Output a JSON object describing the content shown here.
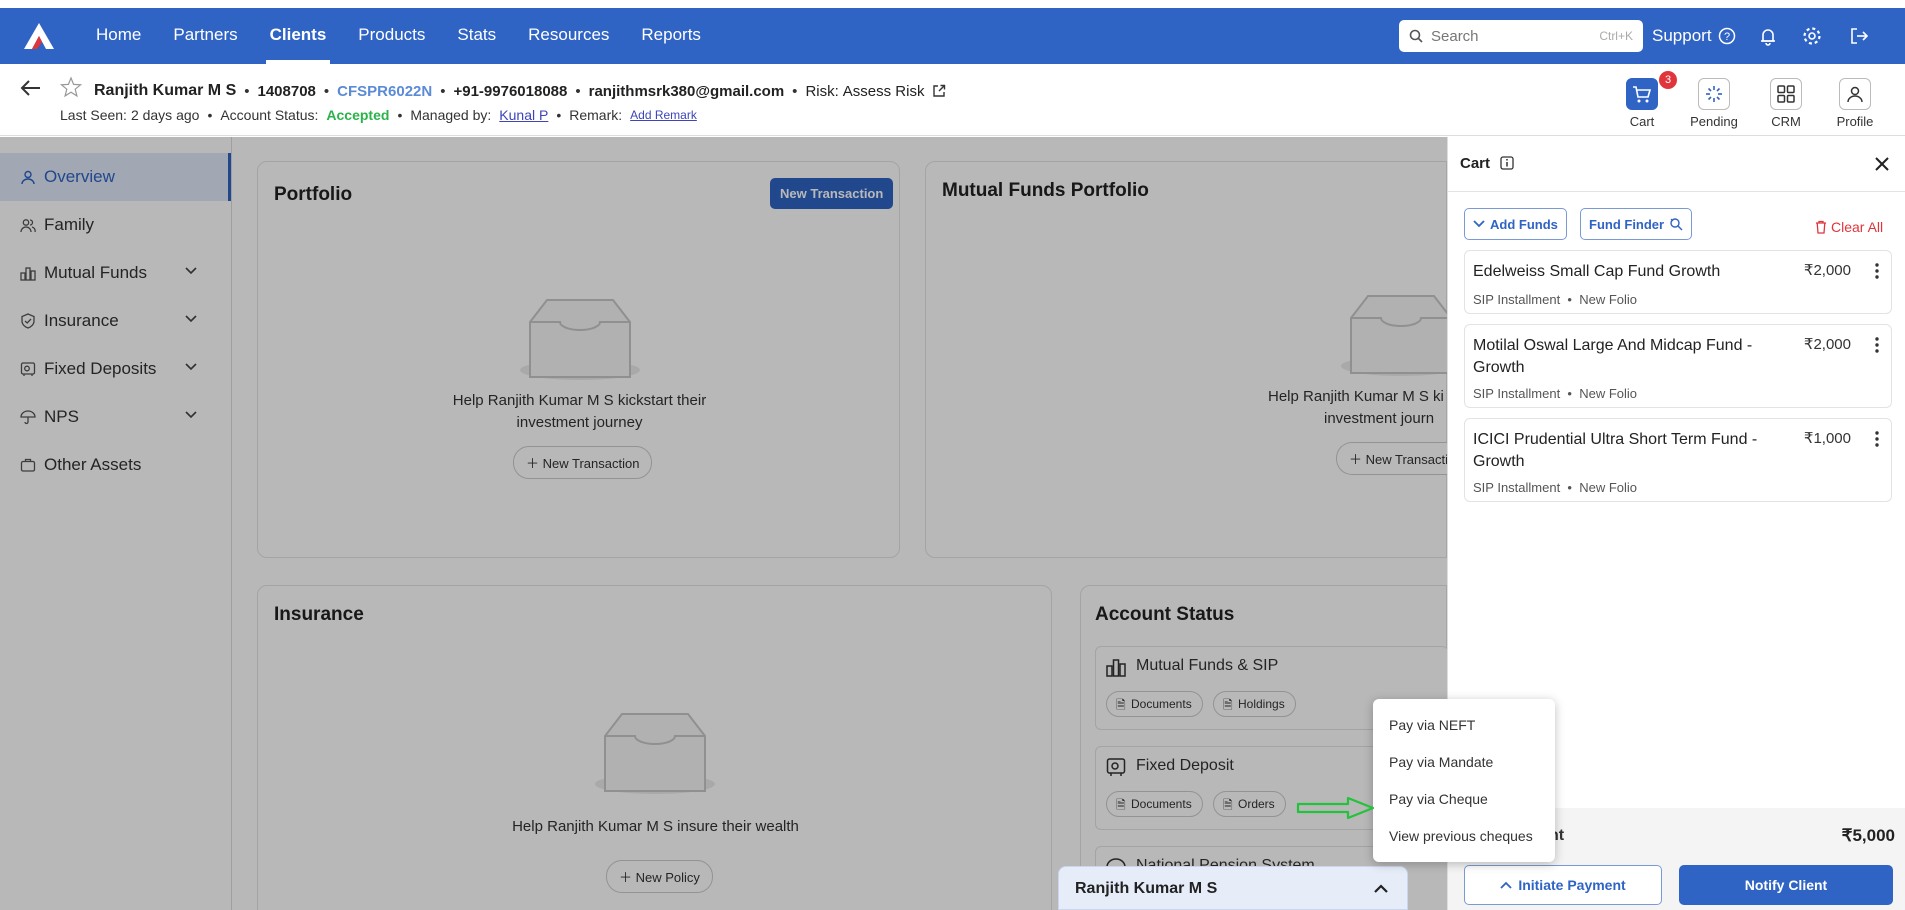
{
  "nav": {
    "items": [
      {
        "label": "Home",
        "active": false
      },
      {
        "label": "Partners",
        "active": false
      },
      {
        "label": "Clients",
        "active": true
      },
      {
        "label": "Products",
        "active": false
      },
      {
        "label": "Stats",
        "active": false
      },
      {
        "label": "Resources",
        "active": false
      },
      {
        "label": "Reports",
        "active": false
      }
    ],
    "search_placeholder": "Search",
    "search_shortcut": "Ctrl+K",
    "support_label": "Support"
  },
  "client": {
    "name": "Ranjith Kumar M S",
    "id": "1408708",
    "pan": "CFSPR6022N",
    "phone": "+91-9976018088",
    "email": "ranjithmsrk380@gmail.com",
    "risk_label": "Risk:",
    "risk_value": "Assess Risk",
    "last_seen_label": "Last Seen:",
    "last_seen_value": "2 days ago",
    "status_label": "Account Status:",
    "status_value": "Accepted",
    "managed_label": "Managed by:",
    "managed_value": "Kunal P",
    "remark_label": "Remark:",
    "remark_action": "Add Remark"
  },
  "quick_actions": [
    {
      "label": "Cart",
      "badge": "3"
    },
    {
      "label": "Pending"
    },
    {
      "label": "CRM"
    },
    {
      "label": "Profile"
    }
  ],
  "sidebar": {
    "items": [
      {
        "label": "Overview"
      },
      {
        "label": "Family"
      },
      {
        "label": "Mutual Funds"
      },
      {
        "label": "Insurance"
      },
      {
        "label": "Fixed Deposits"
      },
      {
        "label": "NPS"
      },
      {
        "label": "Other Assets"
      }
    ]
  },
  "portfolio": {
    "title": "Portfolio",
    "new_transaction": "New Transaction",
    "empty_text_line1": "Help Ranjith Kumar M S kickstart their",
    "empty_text_line2": "investment journey",
    "empty_button": "New Transaction"
  },
  "mf_portfolio": {
    "title": "Mutual Funds Portfolio",
    "empty_text_line1": "Help Ranjith Kumar M S ki",
    "empty_text_line2": "investment journ",
    "empty_button": "New Transactio"
  },
  "insurance": {
    "title": "Insurance",
    "empty_text": "Help Ranjith Kumar M S insure their wealth",
    "empty_button": "New Policy"
  },
  "account_status": {
    "title": "Account Status",
    "rows": [
      {
        "title": "Mutual Funds & SIP",
        "chips": [
          "Documents",
          "Holdings"
        ]
      },
      {
        "title": "Fixed Deposit",
        "chips": [
          "Documents",
          "Orders"
        ]
      },
      {
        "title": "National Pension System",
        "chips": []
      }
    ]
  },
  "dock": {
    "name": "Ranjith Kumar M S"
  },
  "cart": {
    "title": "Cart",
    "add_funds": "Add Funds",
    "fund_finder": "Fund Finder",
    "clear_all": "Clear All",
    "items": [
      {
        "name": "Edelweiss Small Cap Fund Growth",
        "amount": "₹2,000",
        "type": "SIP Installment",
        "folio": "New Folio"
      },
      {
        "name": "Motilal Oswal Large And Midcap Fund - Growth",
        "amount": "₹2,000",
        "type": "SIP Installment",
        "folio": "New Folio"
      },
      {
        "name": "ICICI Prudential Ultra Short Term Fund - Growth",
        "amount": "₹1,000",
        "type": "SIP Installment",
        "folio": "New Folio"
      }
    ],
    "total_label_partial": "nt",
    "total_amount": "₹5,000",
    "initiate_payment": "Initiate Payment",
    "notify_client": "Notify Client"
  },
  "payment_menu": {
    "items": [
      "Pay via NEFT",
      "Pay via Mandate",
      "Pay via Cheque",
      "View previous cheques"
    ]
  },
  "colors": {
    "brand": "#2f63c4",
    "accepted": "#2bb34a",
    "danger": "#e0353a",
    "annotation_arrow": "#22c33a"
  }
}
